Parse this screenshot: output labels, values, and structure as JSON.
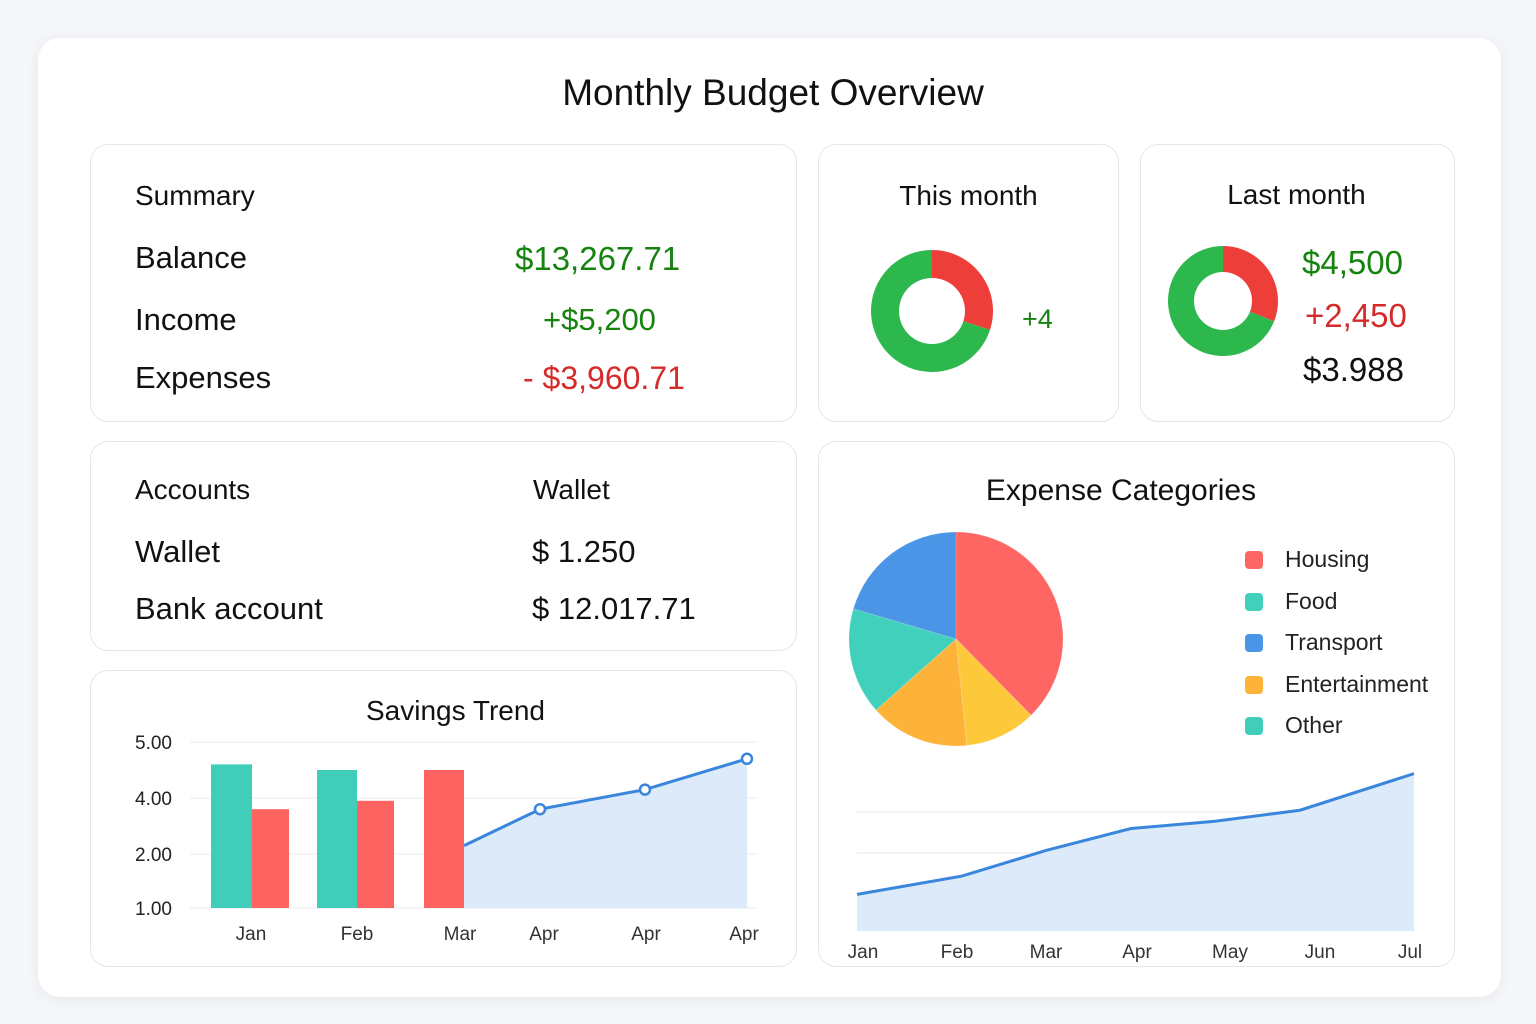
{
  "page": {
    "title": "Monthly Budget Overview"
  },
  "summary": {
    "title": "Summary",
    "rows": [
      {
        "label": "Balance",
        "value": "$13,267.71"
      },
      {
        "label": "Income",
        "value": "+$5,200"
      },
      {
        "label": "Expenses",
        "value": "- $3,960.71"
      }
    ]
  },
  "this_month": {
    "title": "This month",
    "delta": "+4"
  },
  "last_month": {
    "title": "Last month",
    "values": [
      "$4,500",
      "+2,450",
      "$3.988"
    ]
  },
  "accounts": {
    "title": "Accounts",
    "column_header": "Wallet",
    "rows": [
      {
        "label": "Wallet",
        "value": "$ 1.250"
      },
      {
        "label": "Bank account",
        "value": "$ 12.017.71"
      }
    ]
  },
  "colors": {
    "green": "#16830f",
    "red": "#d52a2a",
    "donut_green": "#2db84d",
    "donut_red": "#ee3e3a",
    "teal": "#40cdb9",
    "coral": "#fe6361",
    "blue": "#3a86dc",
    "area_fill": "#dceafa",
    "housing": "#fe6663",
    "food": "#40d0bc",
    "transport": "#4a95e6",
    "entertainment": "#fdb23a",
    "other": "#40cdb9",
    "pie_yellow": "#fdc93a"
  },
  "chart_data": [
    {
      "type": "pie",
      "title": "This month",
      "variant": "donut",
      "values": [
        30,
        70
      ],
      "colors": [
        "#ee3e3a",
        "#2db84d"
      ]
    },
    {
      "type": "pie",
      "title": "Last month",
      "variant": "donut",
      "values": [
        31,
        69
      ],
      "colors": [
        "#ee3e3a",
        "#2db84d"
      ]
    },
    {
      "type": "bar",
      "title": "Savings Trend",
      "yticks": [
        "5.00",
        "4.00",
        "2.00",
        "1.00"
      ],
      "ylim": [
        1,
        5
      ],
      "grid": true,
      "categories": [
        "Jan",
        "Feb",
        "Mar"
      ],
      "series": [
        {
          "values": [
            4.6,
            4.5,
            null
          ],
          "color": "#40cdb9"
        },
        {
          "values": [
            3.6,
            3.9,
            4.5
          ],
          "color": "#fe6361"
        }
      ],
      "line": {
        "points": [
          {
            "x": "Mar",
            "y": 2.3
          },
          {
            "x": "Apr",
            "y": 3.6
          },
          {
            "x": "Apr",
            "y": 4.15
          },
          {
            "x": "Apr",
            "y": 4.7
          }
        ],
        "color": "#3a86dc"
      },
      "xlabels": [
        "Jan",
        "Feb",
        "Mar",
        "Apr",
        "Apr",
        "Apr"
      ]
    },
    {
      "type": "pie",
      "title": "Expense Categories",
      "legend_position": "right",
      "slices": [
        {
          "label": "Housing",
          "value": 35
        },
        {
          "label": "Food",
          "value": 15
        },
        {
          "label": "Transport",
          "value": 19
        },
        {
          "label": "Entertainment",
          "value": 16
        },
        {
          "label": "Other",
          "value": 15
        }
      ],
      "legend": [
        {
          "label": "Housing",
          "color": "#fe6663"
        },
        {
          "label": "Food",
          "color": "#40d0bc"
        },
        {
          "label": "Transport",
          "color": "#4a95e6"
        },
        {
          "label": "Entertainment",
          "color": "#fdb23a"
        },
        {
          "label": "Other",
          "color": "#40cdb9"
        }
      ]
    },
    {
      "type": "area",
      "categories": [
        "Jan",
        "Feb",
        "Mar",
        "Apr",
        "May",
        "Jun",
        "Jul"
      ],
      "values": [
        1.0,
        1.5,
        2.2,
        2.8,
        3.0,
        3.3,
        4.3
      ],
      "ylim": [
        0,
        5
      ],
      "grid": true,
      "color": "#3a86dc"
    }
  ]
}
